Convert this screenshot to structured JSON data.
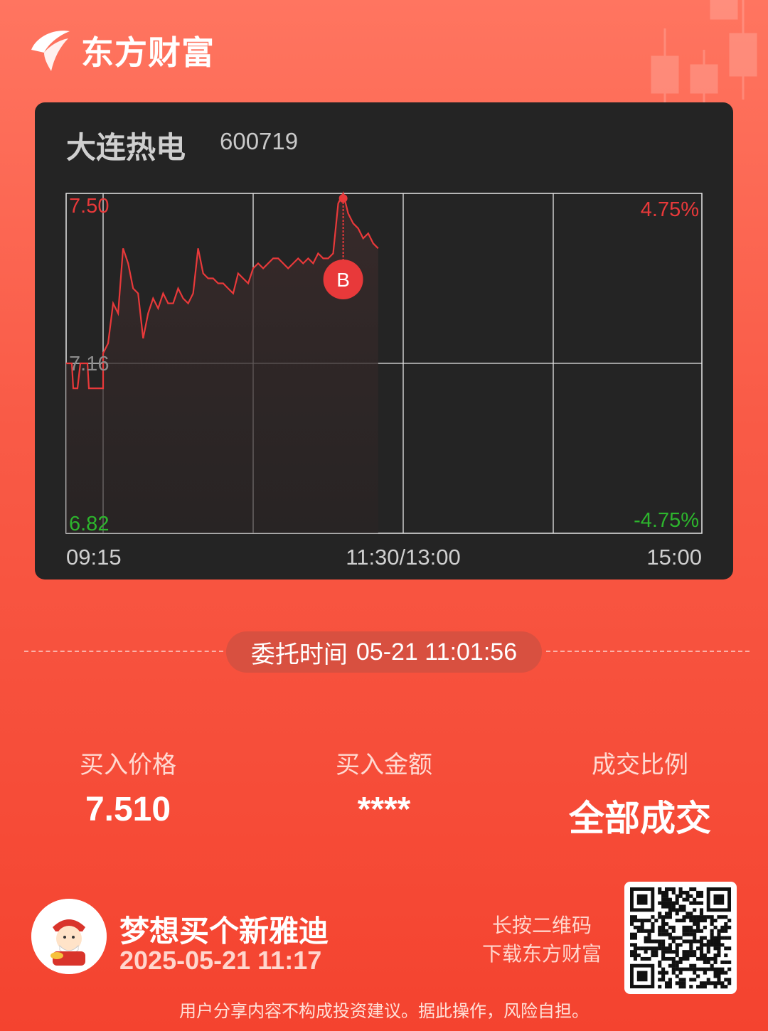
{
  "brand": {
    "name": "东方财富"
  },
  "stock": {
    "name": "大连热电",
    "code": "600719"
  },
  "chart_data": {
    "type": "line",
    "x_ticks": [
      "09:15",
      "11:30/13:00",
      "15:00"
    ],
    "left_axis": {
      "top": "7.50",
      "mid": "7.16",
      "bottom": "6.82"
    },
    "right_axis": {
      "top": "4.75%",
      "bottom": "-4.75%"
    },
    "ylim": [
      6.82,
      7.5
    ],
    "marker": {
      "label": "B",
      "price": 7.5
    },
    "series": [
      {
        "x": [
          0,
          2,
          4,
          6,
          8,
          10,
          12,
          14,
          16,
          18,
          20,
          22,
          24,
          26,
          28,
          30,
          32,
          34,
          36,
          38,
          40,
          42,
          44,
          46,
          48,
          50,
          52,
          54,
          56,
          58,
          60,
          62,
          64,
          66,
          68,
          70,
          72,
          74,
          76,
          78,
          80,
          82,
          84,
          86,
          88,
          90,
          92,
          94,
          96,
          98,
          100,
          102,
          104,
          106,
          108,
          110,
          112,
          114,
          116,
          118,
          120,
          122,
          124
        ],
        "values": [
          7.16,
          7.11,
          7.16,
          7.11,
          7.11,
          7.11,
          7.11,
          7.18,
          7.2,
          7.28,
          7.26,
          7.39,
          7.36,
          7.31,
          7.3,
          7.21,
          7.26,
          7.29,
          7.27,
          7.3,
          7.28,
          7.28,
          7.31,
          7.29,
          7.28,
          7.3,
          7.39,
          7.34,
          7.33,
          7.33,
          7.32,
          7.32,
          7.31,
          7.3,
          7.34,
          7.33,
          7.32,
          7.35,
          7.36,
          7.35,
          7.36,
          7.37,
          7.37,
          7.36,
          7.35,
          7.36,
          7.37,
          7.36,
          7.37,
          7.36,
          7.38,
          7.37,
          7.37,
          7.38,
          7.48,
          7.5,
          7.46,
          7.44,
          7.43,
          7.41,
          7.42,
          7.4,
          7.39
        ]
      }
    ],
    "grid": true
  },
  "order": {
    "label": "委托时间",
    "value": "05-21 11:01:56"
  },
  "stats": {
    "buy_price_label": "买入价格",
    "buy_price": "7.510",
    "amount_label": "买入金额",
    "amount": "****",
    "fill_label": "成交比例",
    "fill": "全部成交"
  },
  "user": {
    "name": "梦想买个新雅迪",
    "time": "2025-05-21 11:17"
  },
  "qr": {
    "tip_line1": "长按二维码",
    "tip_line2": "下载东方财富"
  },
  "disclaimer": "用户分享内容不构成投资建议。据此操作，风险自担。",
  "colors": {
    "up": "#e8393a",
    "down": "#2db52d",
    "card": "#242424"
  }
}
